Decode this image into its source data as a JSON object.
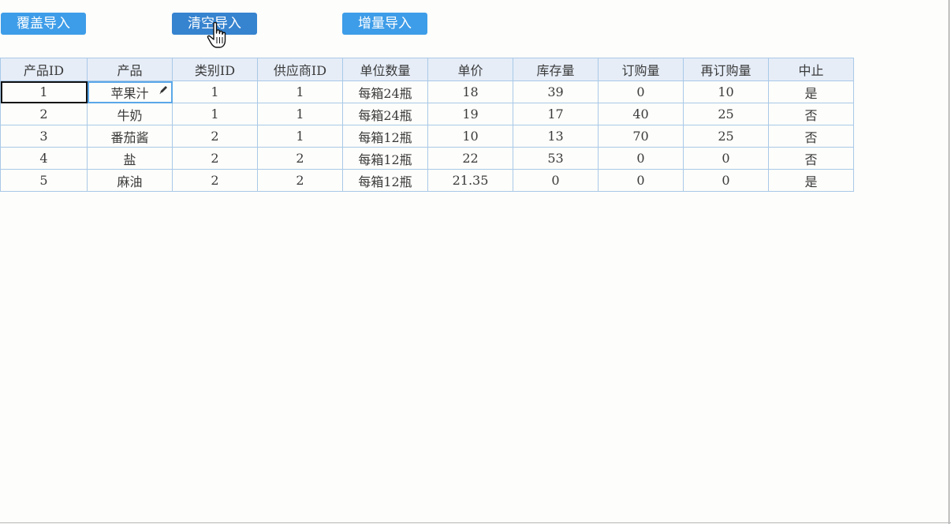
{
  "toolbar": {
    "buttons": [
      {
        "label": "覆盖导入"
      },
      {
        "label": "清空导入"
      },
      {
        "label": "增量导入"
      }
    ]
  },
  "table": {
    "headers": [
      "产品ID",
      "产品",
      "类别ID",
      "供应商ID",
      "单位数量",
      "单价",
      "库存量",
      "订购量",
      "再订购量",
      "中止"
    ],
    "rows": [
      [
        "1",
        "苹果汁",
        "1",
        "1",
        "每箱24瓶",
        "18",
        "39",
        "0",
        "10",
        "是"
      ],
      [
        "2",
        "牛奶",
        "1",
        "1",
        "每箱24瓶",
        "19",
        "17",
        "40",
        "25",
        "否"
      ],
      [
        "3",
        "番茄酱",
        "2",
        "1",
        "每箱12瓶",
        "10",
        "13",
        "70",
        "25",
        "否"
      ],
      [
        "4",
        "盐",
        "2",
        "2",
        "每箱12瓶",
        "22",
        "53",
        "0",
        "0",
        "否"
      ],
      [
        "5",
        "麻油",
        "2",
        "2",
        "每箱12瓶",
        "21.35",
        "0",
        "0",
        "0",
        "是"
      ]
    ]
  },
  "icons": {
    "cursor": "hand-pointer-icon",
    "edit": "pencil-icon"
  },
  "colors": {
    "button": "#3e9de8",
    "button_active": "#3683cf",
    "header_bg": "#e6edf7",
    "grid_border": "#a9c9e7",
    "selection": "#111111",
    "edit_outline": "#5aa7e8"
  }
}
